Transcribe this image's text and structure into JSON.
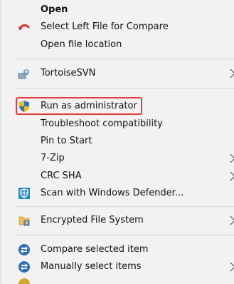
{
  "menu": {
    "items": [
      {
        "label": "Open"
      },
      {
        "label": "Select Left File for Compare",
        "icon": "undo-arrow-icon"
      },
      {
        "label": "Open file location"
      },
      {
        "label": "TortoiseSVN",
        "icon": "tortoisesvn-icon"
      },
      {
        "label": "Run as administrator",
        "icon": "shield-icon"
      },
      {
        "label": "Troubleshoot compatibility"
      },
      {
        "label": "Pin to Start"
      },
      {
        "label": "7-Zip"
      },
      {
        "label": "CRC SHA"
      },
      {
        "label": "Scan with Windows Defender...",
        "icon": "windows-defender-icon"
      },
      {
        "label": "Encrypted File System",
        "icon": "encrypted-file-icon"
      },
      {
        "label": "Compare selected item",
        "icon": "compare-icon"
      },
      {
        "label": "Manually select items",
        "icon": "compare-icon"
      }
    ]
  },
  "colors": {
    "menu_background": "#f2f2f2",
    "separator": "#d7d7d7",
    "highlight_border": "#e43a3a",
    "undo_arrow": "#d9322b",
    "defender_blue": "#1e88c9",
    "compare_blue": "#2a6fb5",
    "shield_yellow": "#f5c000",
    "shield_blue": "#2b6fd6"
  }
}
